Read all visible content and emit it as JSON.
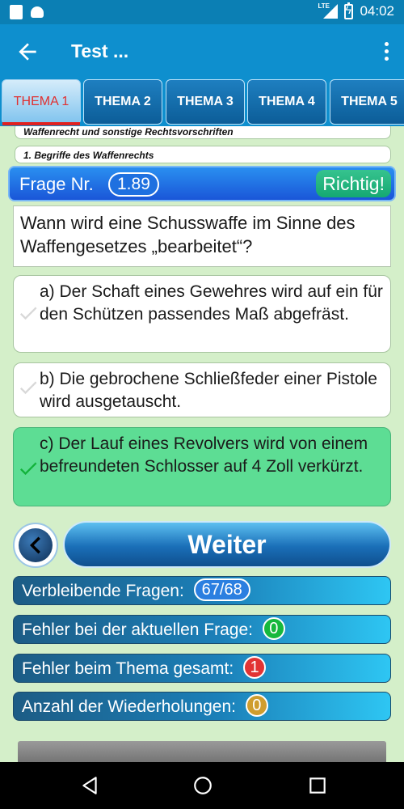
{
  "status_bar": {
    "network": "LTE",
    "time": "04:02",
    "icons": [
      "sd-card-icon",
      "android-icon",
      "signal-icon",
      "battery-charging-icon"
    ]
  },
  "app_bar": {
    "title": "Test ...",
    "back_icon": "arrow-left-icon",
    "menu_icon": "more-vert-icon"
  },
  "tabs": [
    {
      "label": "THEMA 1",
      "active": true
    },
    {
      "label": "THEMA 2",
      "active": false
    },
    {
      "label": "THEMA 3",
      "active": false
    },
    {
      "label": "THEMA 4",
      "active": false
    },
    {
      "label": "THEMA 5",
      "active": false
    }
  ],
  "topic": {
    "chapter": "Waffenrecht und sonstige Rechtsvorschriften",
    "section": "1. Begriffe des Waffenrechts"
  },
  "question": {
    "number_label": "Frage Nr.",
    "number": "1.89",
    "status": "Richtig!",
    "text": "Wann wird eine Schusswaffe im Sinne des Waffengesetzes „bearbeitet“?"
  },
  "answers": [
    {
      "text": "a) Der Schaft eines Gewehres wird auf ein für den Schützen passendes Maß abgefräst.",
      "selected": false
    },
    {
      "text": "b) Die gebrochene Schließfeder einer Pistole wird ausgetauscht.",
      "selected": false
    },
    {
      "text": "c) Der Lauf eines Revolvers wird von einem befreundeten Schlosser auf 4 Zoll verkürzt.",
      "selected": true
    }
  ],
  "navigation": {
    "next_label": "Weiter",
    "prev_icon": "chevron-left-icon"
  },
  "stats": {
    "remaining_label": "Verbleibende Fragen:",
    "remaining_value": "67/68",
    "errors_current_label": "Fehler bei der aktuellen Frage:",
    "errors_current_value": "0",
    "errors_total_label": "Fehler beim Thema gesamt:",
    "errors_total_value": "1",
    "repeats_label": "Anzahl der Wiederholungen:",
    "repeats_value": "0"
  },
  "colors": {
    "app_bar": "#0e8fce",
    "correct_answer": "#5ddd94",
    "background": "#d4efc9"
  }
}
